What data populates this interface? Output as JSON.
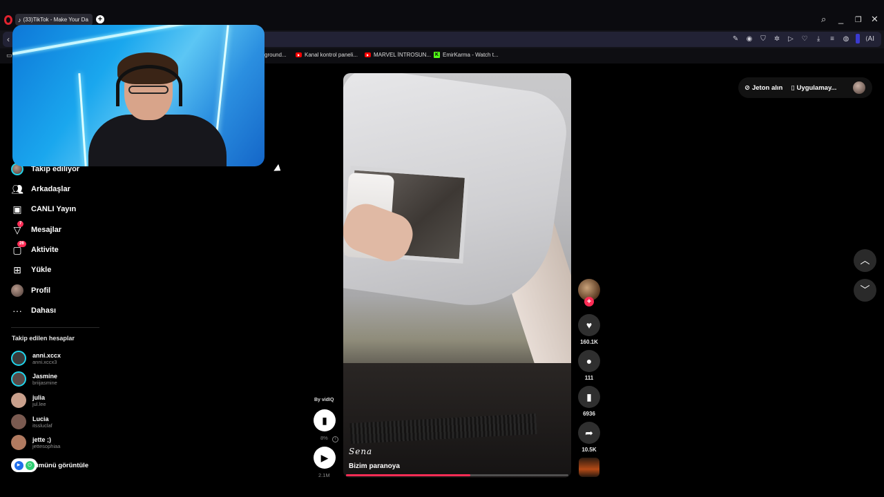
{
  "browser": {
    "tab_title": "(33)TikTok - Make Your Da",
    "tab_icon": "tiktok-icon",
    "bookmarks": [
      {
        "label": "ground...",
        "icon": "none"
      },
      {
        "label": "Kanal kontrol paneli...",
        "icon": "youtube-icon"
      },
      {
        "label": "MARVEL İNTROSUN...",
        "icon": "youtube-icon"
      },
      {
        "label": "EmirKarma - Watch t...",
        "icon": "kick-icon"
      }
    ],
    "ai_label": "AI",
    "accent": "#e0232e"
  },
  "sidebar": {
    "nav": [
      {
        "label": "Takip ediliyor",
        "icon": "following-avatar-icon",
        "badge": ""
      },
      {
        "label": "Arkadaşlar",
        "icon": "friends-icon",
        "badge": ""
      },
      {
        "label": "CANLI Yayın",
        "icon": "live-icon",
        "badge": ""
      },
      {
        "label": "Mesajlar",
        "icon": "messages-icon",
        "badge": "7"
      },
      {
        "label": "Aktivite",
        "icon": "activity-icon",
        "badge": "26"
      },
      {
        "label": "Yükle",
        "icon": "upload-icon",
        "badge": ""
      },
      {
        "label": "Profil",
        "icon": "profile-avatar-icon",
        "badge": ""
      },
      {
        "label": "Dahası",
        "icon": "more-icon",
        "badge": ""
      }
    ],
    "followed_title": "Takip edilen hesaplar",
    "accounts": [
      {
        "name": "anni.xccx",
        "user": "anni.xccx3",
        "color": "#3a3a3a"
      },
      {
        "name": "Jasmine",
        "user": "briijasmine",
        "color": "#5a4a48"
      },
      {
        "name": "julia",
        "user": "jul.lee",
        "color": "#c9a08c"
      },
      {
        "name": "Lucia",
        "user": "itssluclaf",
        "color": "#7a5a50"
      },
      {
        "name": "jette ;)",
        "user": "jettesophiaa",
        "color": "#b07a60"
      }
    ],
    "see_all": "ümünü görüntüle"
  },
  "video": {
    "signature": "Sena",
    "caption": "Bizim paranoya",
    "progress": 0.56
  },
  "actions": {
    "likes": "160.1K",
    "comments": "111",
    "saves": "6936",
    "shares": "10.5K"
  },
  "vidiq": {
    "by_label": "By vidIQ",
    "percent": "8%",
    "views": "2.1M"
  },
  "top_right": {
    "coins": "Jeton alın",
    "app": "Uygulamay..."
  },
  "colors": {
    "tiktok_red": "#fe2c55",
    "live_ring": "#20d5ec"
  }
}
